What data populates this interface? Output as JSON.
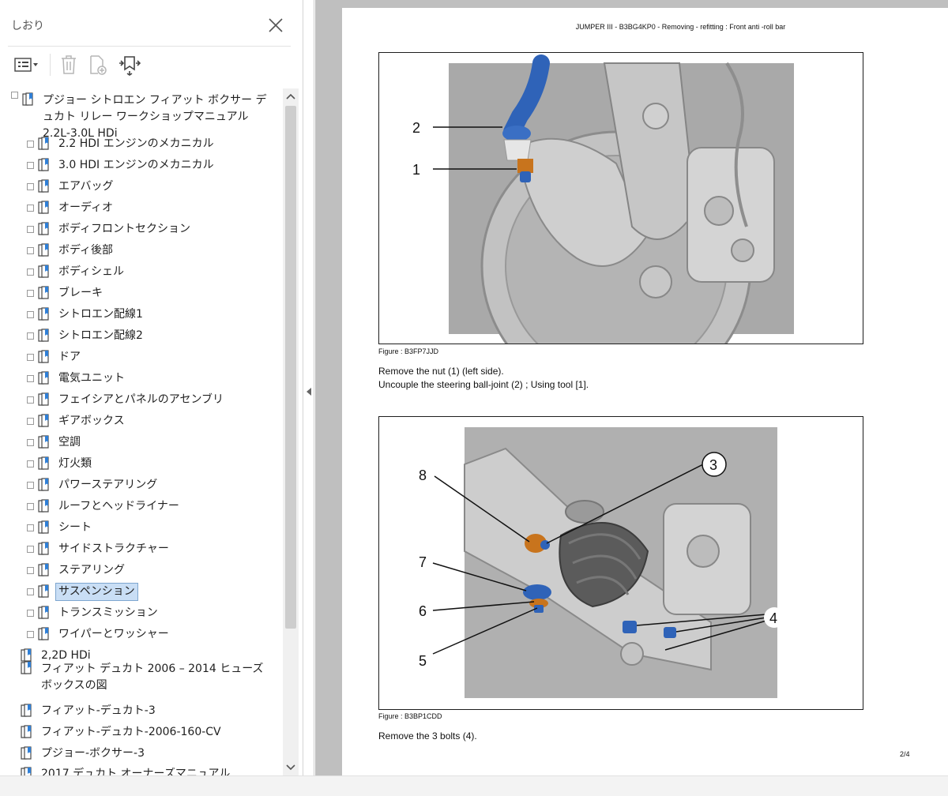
{
  "bookmarks_panel": {
    "title": "しおり",
    "tree": [
      {
        "label": "プジョー シトロエン フィアット ボクサー デュカト リレー ワークショップマニュアル 2.2L-3.0L  HDi",
        "level": 0,
        "toggle": true,
        "selected": false
      },
      {
        "label": "2.2 HDI エンジンのメカニカル",
        "level": 1,
        "toggle": true,
        "selected": false
      },
      {
        "label": "3.0 HDI エンジンのメカニカル",
        "level": 1,
        "toggle": true,
        "selected": false
      },
      {
        "label": "エアバッグ",
        "level": 1,
        "toggle": true,
        "selected": false
      },
      {
        "label": "オーディオ",
        "level": 1,
        "toggle": true,
        "selected": false
      },
      {
        "label": "ボディフロントセクション",
        "level": 1,
        "toggle": true,
        "selected": false
      },
      {
        "label": "ボディ後部",
        "level": 1,
        "toggle": true,
        "selected": false
      },
      {
        "label": "ボディシェル",
        "level": 1,
        "toggle": true,
        "selected": false
      },
      {
        "label": "ブレーキ",
        "level": 1,
        "toggle": true,
        "selected": false
      },
      {
        "label": "シトロエン配線1",
        "level": 1,
        "toggle": true,
        "selected": false
      },
      {
        "label": "シトロエン配線2",
        "level": 1,
        "toggle": true,
        "selected": false
      },
      {
        "label": "ドア",
        "level": 1,
        "toggle": true,
        "selected": false
      },
      {
        "label": "電気ユニット",
        "level": 1,
        "toggle": true,
        "selected": false
      },
      {
        "label": "フェイシアとパネルのアセンブリ",
        "level": 1,
        "toggle": true,
        "selected": false
      },
      {
        "label": "ギアボックス",
        "level": 1,
        "toggle": true,
        "selected": false
      },
      {
        "label": "空調",
        "level": 1,
        "toggle": true,
        "selected": false
      },
      {
        "label": "灯火類",
        "level": 1,
        "toggle": true,
        "selected": false
      },
      {
        "label": "パワーステアリング",
        "level": 1,
        "toggle": true,
        "selected": false
      },
      {
        "label": "ルーフとヘッドライナー",
        "level": 1,
        "toggle": true,
        "selected": false
      },
      {
        "label": "シート",
        "level": 1,
        "toggle": true,
        "selected": false
      },
      {
        "label": "サイドストラクチャー",
        "level": 1,
        "toggle": true,
        "selected": false
      },
      {
        "label": "ステアリング",
        "level": 1,
        "toggle": true,
        "selected": false
      },
      {
        "label": "サスペンション",
        "level": 1,
        "toggle": true,
        "selected": true
      },
      {
        "label": "トランスミッション",
        "level": 1,
        "toggle": true,
        "selected": false
      },
      {
        "label": "ワイパーとワッシャー",
        "level": 1,
        "toggle": true,
        "selected": false
      },
      {
        "label": "2,2D HDi",
        "level": 0,
        "toggle": false,
        "selected": false
      },
      {
        "label": "フィアット デュカト 2006 – 2014 ヒューズ ボックスの図",
        "level": 0,
        "toggle": false,
        "selected": false
      },
      {
        "label": "フィアット-デュカト-3",
        "level": 0,
        "toggle": false,
        "selected": false
      },
      {
        "label": "フィアット-デュカト-2006-160-CV",
        "level": 0,
        "toggle": false,
        "selected": false
      },
      {
        "label": "プジョー-ボクサー-3",
        "level": 0,
        "toggle": false,
        "selected": false
      },
      {
        "label": "2017 デュカト オーナーズマニュアル",
        "level": 0,
        "toggle": false,
        "selected": false
      }
    ]
  },
  "document": {
    "header": "JUMPER III - B3BG4KP0 - Removing - refitting : Front anti -roll bar",
    "figure1": {
      "caption": "Figure : B3FP7JJD",
      "callouts": [
        "2",
        "1"
      ]
    },
    "text1_line1": "Remove the nut (1) (left side).",
    "text1_line2": "Uncouple the steering ball-joint (2) ; Using tool [1].",
    "figure2": {
      "caption": "Figure : B3BP1CDD",
      "callouts": [
        "8",
        "3",
        "7",
        "6",
        "5",
        "4"
      ]
    },
    "text2": "Remove the 3 bolts (4).",
    "page_number": "2/4"
  },
  "icons": {
    "bookmark": "bookmark-page-icon",
    "toolbar": [
      "options-menu-icon",
      "delete-icon",
      "new-bookmark-icon",
      "expand-bookmark-icon"
    ],
    "close": "close-icon"
  },
  "colors": {
    "selection_fill": "#c9def5",
    "selection_border": "#7ea6cf",
    "viewer_bg": "#bfbfbf",
    "part_blue": "#2f63b8",
    "part_orange": "#c8741d"
  }
}
